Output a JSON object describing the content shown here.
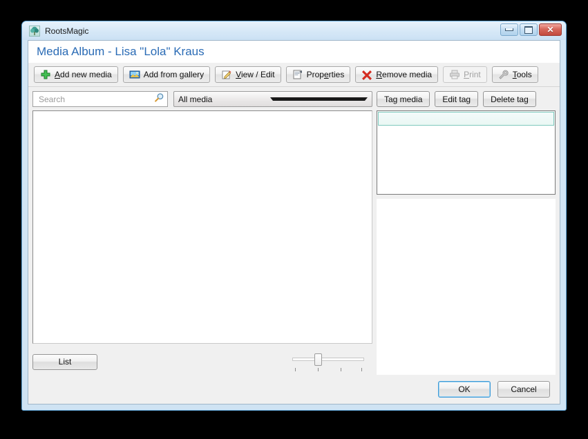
{
  "window": {
    "app_title": "RootsMagic",
    "app_icon": "tree-icon",
    "controls": {
      "minimize": "minimize-icon",
      "maximize": "maximize-icon",
      "close": "close-icon"
    }
  },
  "header": {
    "page_title": "Media Album - Lisa \"Lola\" Kraus"
  },
  "toolbar": {
    "buttons": [
      {
        "name": "add-new-media",
        "icon": "green-plus-icon",
        "pre": "",
        "accel": "A",
        "post": "dd new media",
        "disabled": false
      },
      {
        "name": "add-from-gallery",
        "icon": "picture-icon",
        "pre": "Add from ",
        "accel": "g",
        "post": "allery",
        "disabled": false
      },
      {
        "name": "view-edit",
        "icon": "pencil-edit-icon",
        "pre": "",
        "accel": "V",
        "post": "iew / Edit",
        "disabled": false
      },
      {
        "name": "properties",
        "icon": "clipboard-icon",
        "pre": "Prop",
        "accel": "e",
        "post": "rties",
        "disabled": false
      },
      {
        "name": "remove-media",
        "icon": "red-x-icon",
        "pre": "",
        "accel": "R",
        "post": "emove media",
        "disabled": false
      },
      {
        "name": "print",
        "icon": "printer-icon",
        "pre": "",
        "accel": "P",
        "post": "rint",
        "disabled": true
      },
      {
        "name": "tools",
        "icon": "wrench-icon",
        "pre": "",
        "accel": "T",
        "post": "ools",
        "disabled": false
      }
    ]
  },
  "search": {
    "value": "",
    "placeholder": "Search",
    "icon": "magnifier-icon"
  },
  "filter": {
    "selected": "All media",
    "icon": "chevron-down-icon"
  },
  "media_panel": {
    "items": []
  },
  "left_bottom": {
    "list_button": "List",
    "zoom_slider": {
      "ticks": 4,
      "value": 2,
      "min": 1,
      "max": 4
    }
  },
  "tag_panel": {
    "buttons": [
      {
        "name": "tag-media",
        "label": "Tag media"
      },
      {
        "name": "edit-tag",
        "label": "Edit tag"
      },
      {
        "name": "delete-tag",
        "label": "Delete tag"
      }
    ],
    "rows": [
      {
        "label": "",
        "selected": true
      }
    ]
  },
  "footer": {
    "ok": "OK",
    "cancel": "Cancel"
  },
  "colors": {
    "title_link": "#2a6bb5",
    "frame": "#5ea5d8",
    "selection_border": "#7fc9bd",
    "close_button": "#c2493c"
  }
}
